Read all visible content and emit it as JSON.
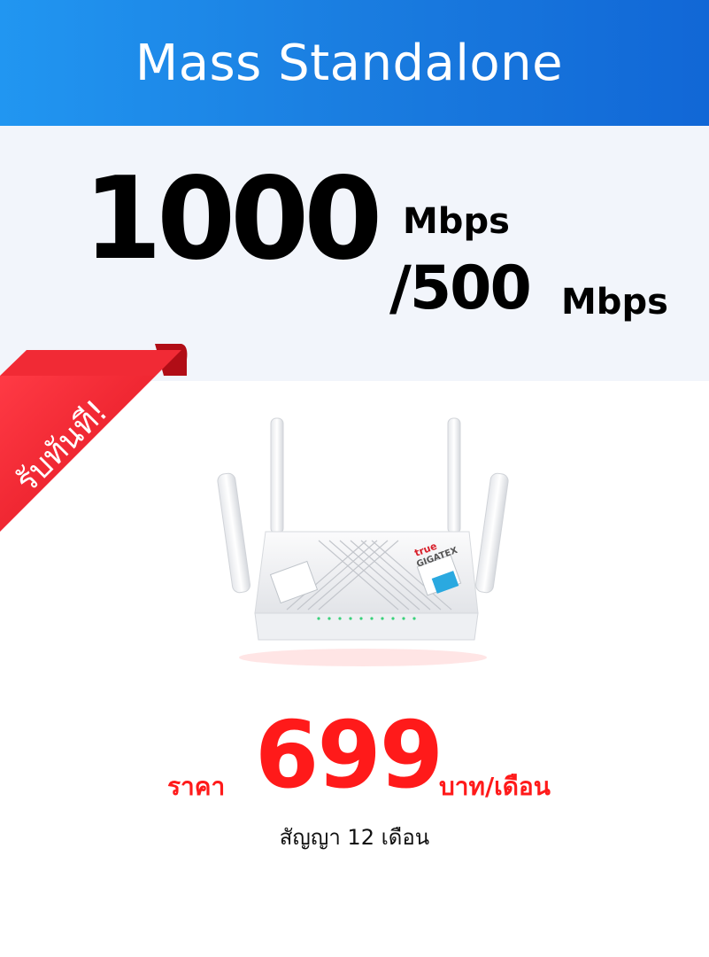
{
  "header": {
    "title": "Mass Standalone",
    "color_start": "#2196f1",
    "color_end": "#1167d6"
  },
  "speed": {
    "download": "1000",
    "download_unit": "Mbps",
    "upload": "/500",
    "upload_unit": "Mbps"
  },
  "badge": {
    "text": "รับทันที!",
    "color": "#ef2233"
  },
  "product": {
    "name": "router",
    "brand_text": "true GIGATEX"
  },
  "price": {
    "label": "ราคา",
    "amount": "699",
    "unit": "บาท/เดือน",
    "color": "#ff1a1a"
  },
  "contract": {
    "text": "สัญญา 12 เดือน"
  }
}
